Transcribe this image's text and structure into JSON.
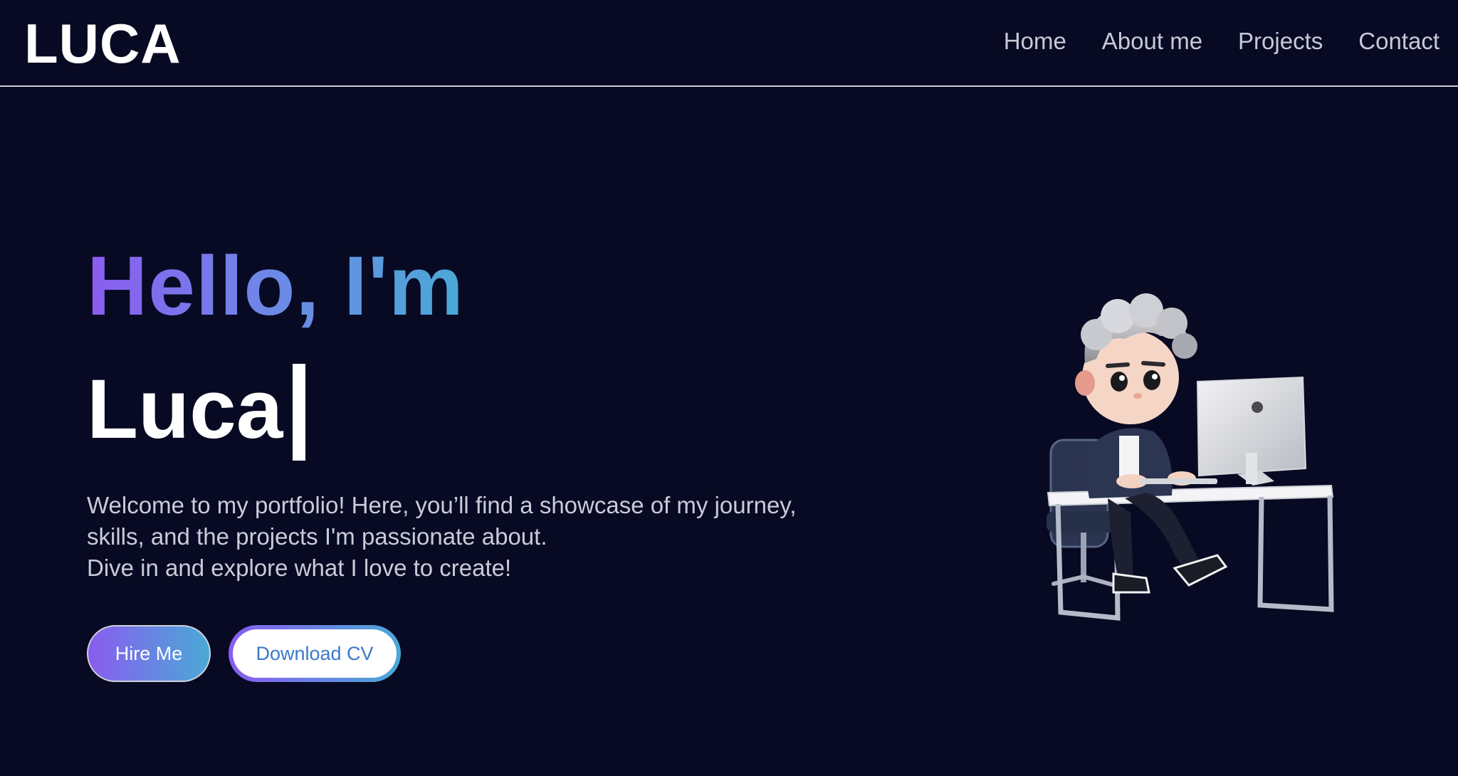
{
  "header": {
    "logo": "LUCA",
    "nav": [
      "Home",
      "About me",
      "Projects",
      "Contact"
    ]
  },
  "hero": {
    "greeting": "Hello, I'm",
    "name": "Luca",
    "intro_lines": [
      "Welcome to my portfolio! Here, you’ll find a showcase of my journey,",
      "skills, and the projects I'm passionate about.",
      "Dive in and explore what I love to create!"
    ],
    "hire_label": "Hire Me",
    "download_label": "Download CV"
  },
  "colors": {
    "background": "#070a22",
    "gradient_start": "#8b5cf0",
    "gradient_end": "#4aa9d6",
    "text_muted": "#c9ccd8"
  },
  "illustration": {
    "icon": "developer-at-desk-illustration"
  }
}
